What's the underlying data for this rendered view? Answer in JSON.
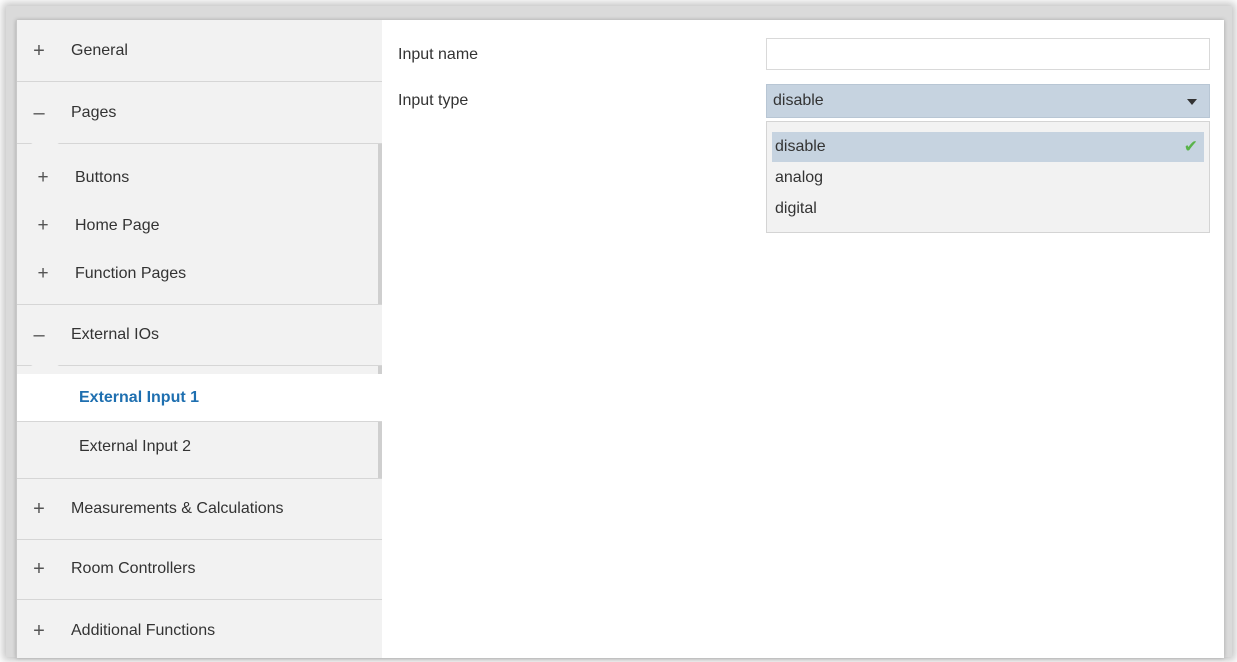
{
  "sidebar": {
    "sections": [
      {
        "label": "General",
        "symbol": "+"
      },
      {
        "label": "Pages",
        "symbol": "–"
      },
      {
        "label": "External IOs",
        "symbol": "–"
      },
      {
        "label": "Measurements & Calculations",
        "symbol": "+"
      },
      {
        "label": "Room Controllers",
        "symbol": "+"
      },
      {
        "label": "Additional Functions",
        "symbol": "+"
      }
    ],
    "pages_items": [
      {
        "label": "Buttons",
        "symbol": "+"
      },
      {
        "label": "Home Page",
        "symbol": "+"
      },
      {
        "label": "Function Pages",
        "symbol": "+"
      }
    ],
    "external_items": [
      {
        "label": "External Input 1",
        "active": true
      },
      {
        "label": "External Input 2",
        "active": false
      }
    ]
  },
  "main": {
    "input_name_label": "Input name",
    "input_name_value": "",
    "input_type_label": "Input type",
    "input_type_value": "disable",
    "options": [
      "disable",
      "analog",
      "digital"
    ],
    "selected_option": "disable",
    "check_glyph": "✔"
  },
  "colors": {
    "active_text": "#1e6fb0",
    "select_bg": "#c6d3e0",
    "check": "#59b34a",
    "sidebar_bg": "#f2f2f2"
  }
}
